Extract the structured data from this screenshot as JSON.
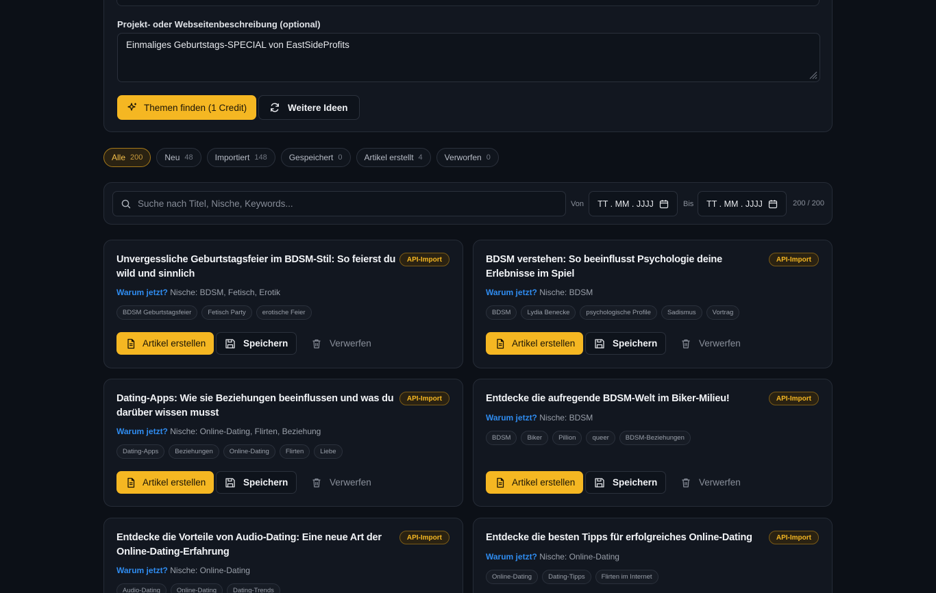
{
  "form": {
    "description_label": "Projekt- oder Webseitenbeschreibung (optional)",
    "description_value": "Einmaliges Geburtstags-SPECIAL von EastSideProfits",
    "find_topics_label": "Themen finden (1 Credit)",
    "more_ideas_label": "Weitere Ideen"
  },
  "filters": [
    {
      "label": "Alle",
      "count": "200",
      "active": true
    },
    {
      "label": "Neu",
      "count": "48"
    },
    {
      "label": "Importiert",
      "count": "148"
    },
    {
      "label": "Gespeichert",
      "count": "0"
    },
    {
      "label": "Artikel erstellt",
      "count": "4"
    },
    {
      "label": "Verworfen",
      "count": "0"
    }
  ],
  "search": {
    "placeholder": "Suche nach Titel, Nische, Keywords...",
    "from_label": "Von",
    "to_label": "Bis",
    "date_placeholder": "TT . MM . JJJJ",
    "result_count": "200 / 200"
  },
  "card_labels": {
    "badge": "API-Import",
    "why_label": "Warum jetzt?",
    "create": "Artikel erstellen",
    "save": "Speichern",
    "discard": "Verwerfen"
  },
  "cards": [
    {
      "title": "Unvergessliche Geburtstagsfeier im BDSM-Stil: So feierst du wild und sinnlich",
      "niche": "Nische: BDSM, Fetisch, Erotik",
      "tags": [
        "BDSM Geburtstagsfeier",
        "Fetisch Party",
        "erotische Feier"
      ]
    },
    {
      "title": "BDSM verstehen: So beeinflusst Psychologie deine Erlebnisse im Spiel",
      "niche": "Nische: BDSM",
      "tags": [
        "BDSM",
        "Lydia Benecke",
        "psychologische Profile",
        "Sadismus",
        "Vortrag"
      ]
    },
    {
      "title": "Dating-Apps: Wie sie Beziehungen beeinflussen und was du darüber wissen musst",
      "niche": "Nische: Online-Dating, Flirten, Beziehung",
      "tags": [
        "Dating-Apps",
        "Beziehungen",
        "Online-Dating",
        "Flirten",
        "Liebe"
      ]
    },
    {
      "title": "Entdecke die aufregende BDSM-Welt im Biker-Milieu!",
      "niche": "Nische: BDSM",
      "tags": [
        "BDSM",
        "Biker",
        "Pillion",
        "queer",
        "BDSM-Beziehungen"
      ]
    },
    {
      "title": "Entdecke die Vorteile von Audio-Dating: Eine neue Art der Online-Dating-Erfahrung",
      "niche": "Nische: Online-Dating",
      "tags": [
        "Audio-Dating",
        "Online-Dating",
        "Dating-Trends"
      ]
    },
    {
      "title": "Entdecke die besten Tipps für erfolgreiches Online-Dating",
      "niche": "Nische: Online-Dating",
      "tags": [
        "Online-Dating",
        "Dating-Tipps",
        "Flirten im Internet"
      ]
    }
  ]
}
